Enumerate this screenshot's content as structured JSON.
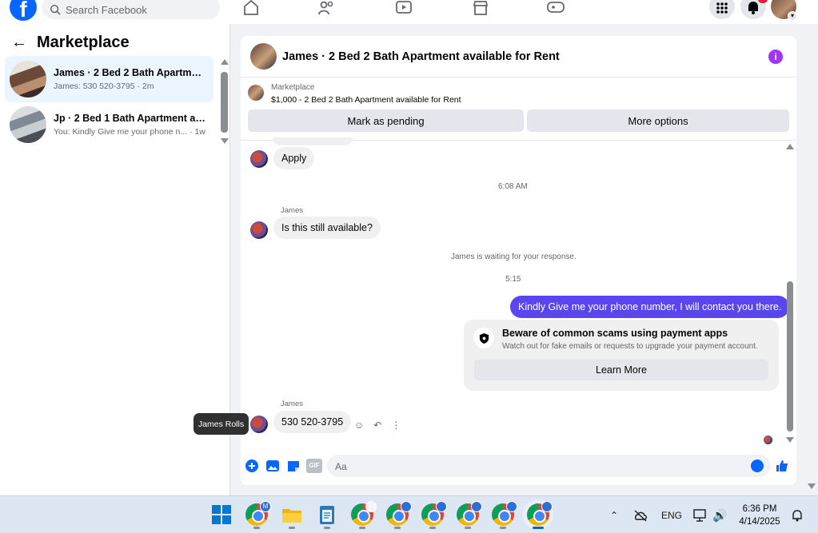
{
  "topbar": {
    "logo_letter": "f",
    "search_placeholder": "Search Facebook",
    "nav_icons": [
      "home-icon",
      "friends-icon",
      "video-icon",
      "marketplace-icon",
      "gaming-icon"
    ],
    "right_icons": [
      "menu-grid-icon",
      "notifications-icon",
      "account-avatar"
    ]
  },
  "left": {
    "back_icon": "arrow-left-icon",
    "title": "Marketplace",
    "conversations": [
      {
        "title": "James · 2 Bed 2 Bath Apartment...",
        "snippet": "James: 530 520-3795 · 2m",
        "active": true
      },
      {
        "title": "Jp · 2 Bed 1 Bath Apartment ava...",
        "snippet": "You: Kindly Give me your phone n... · 1w",
        "active": false
      }
    ]
  },
  "chat": {
    "header_title": "James · 2 Bed 2 Bath Apartment available for Rent",
    "info_icon": "i",
    "listing": {
      "label": "Marketplace",
      "price_title": "$1,000 - 2 Bed 2 Bath Apartment available for Rent",
      "mark_pending": "Mark as pending",
      "more_options": "More options"
    },
    "messages": {
      "apply": "Apply",
      "time1": "6:08 AM",
      "sender1": "James",
      "still_available": "Is this still available?",
      "waiting": "James is waiting for your response.",
      "time2": "5:15",
      "outgoing": "Kindly Give me your phone number, I will contact you there.",
      "scam_title": "Beware of common scams using payment apps",
      "scam_sub": "Watch out for fake emails or requests to upgrade your payment account.",
      "learn_more": "Learn More",
      "sender2": "James",
      "phone": "530 520-3795",
      "tooltip": "James Rolls"
    },
    "composer": {
      "placeholder": "Aa",
      "icons": [
        "plus-circle-icon",
        "photo-icon",
        "sticker-icon",
        "gif-icon",
        "emoji-icon",
        "like-icon"
      ],
      "gif_label": "GIF"
    }
  },
  "taskbar": {
    "apps": [
      "windows-start-icon",
      "chrome-profile-m",
      "file-explorer-icon",
      "notepad-icon",
      "chrome-profile-1",
      "chrome-profile-2",
      "chrome-profile-3",
      "chrome-profile-4",
      "chrome-profile-5",
      "chrome-profile-6"
    ],
    "first_badge": "M",
    "lang": "ENG",
    "time": "6:36 PM",
    "date": "4/14/2025"
  },
  "colors": {
    "fb_blue": "#0866ff",
    "outgoing_bubble": "#5a46f0",
    "info_purple": "#a033ff",
    "notification_red": "#e41e3f"
  }
}
